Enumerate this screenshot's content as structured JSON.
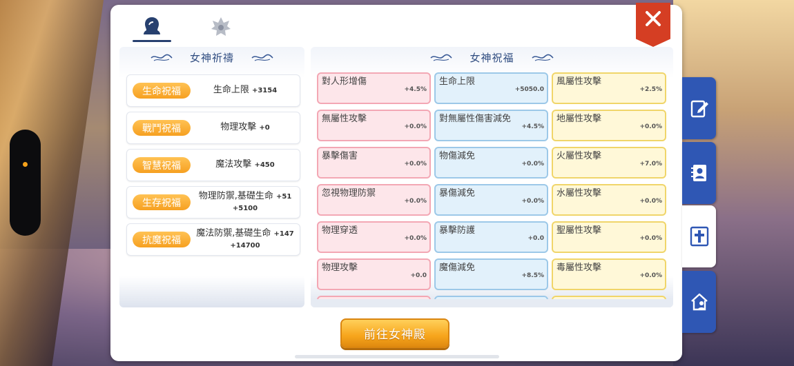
{
  "colors": {
    "accent_orange": "#f6a021",
    "title_blue": "#2f4c80",
    "close_red": "#d53e23",
    "side_tab_blue": "#2f57b4",
    "cell_pink": "#fde6ea",
    "cell_blue": "#e2f1fb",
    "cell_yellow": "#fff8d8"
  },
  "top_tabs": [
    {
      "icon": "goddess-icon",
      "active": true
    },
    {
      "icon": "emblem-icon",
      "active": false
    }
  ],
  "close": {
    "icon": "close-icon"
  },
  "prayer": {
    "title": "女神祈禱",
    "items": [
      {
        "badge": "生命祝福",
        "stat": "生命上限",
        "bonus": "+3154",
        "sub": ""
      },
      {
        "badge": "戰鬥祝福",
        "stat": "物理攻擊",
        "bonus": "+0",
        "sub": ""
      },
      {
        "badge": "智慧祝福",
        "stat": "魔法攻擊",
        "bonus": "+450",
        "sub": ""
      },
      {
        "badge": "生存祝福",
        "stat": "物理防禦,基礎生命",
        "bonus": "+51",
        "sub": "+5100"
      },
      {
        "badge": "抗魔祝福",
        "stat": "魔法防禦,基礎生命",
        "bonus": "+147",
        "sub": "+14700"
      }
    ]
  },
  "blessing": {
    "title": "女神祝福",
    "rows": [
      [
        {
          "name": "對人形增傷",
          "value": "+4.5%"
        },
        {
          "name": "生命上限",
          "value": "+5050.0"
        },
        {
          "name": "風屬性攻擊",
          "value": "+2.5%"
        }
      ],
      [
        {
          "name": "無屬性攻擊",
          "value": "+0.0%"
        },
        {
          "name": "對無屬性傷害減免",
          "value": "+4.5%"
        },
        {
          "name": "地屬性攻擊",
          "value": "+0.0%"
        }
      ],
      [
        {
          "name": "暴擊傷害",
          "value": "+0.0%"
        },
        {
          "name": "物傷減免",
          "value": "+0.0%"
        },
        {
          "name": "火屬性攻擊",
          "value": "+7.0%"
        }
      ],
      [
        {
          "name": "忽視物理防禦",
          "value": "+0.0%"
        },
        {
          "name": "暴傷減免",
          "value": "+0.0%"
        },
        {
          "name": "水屬性攻擊",
          "value": "+0.0%"
        }
      ],
      [
        {
          "name": "物理穿透",
          "value": "+0.0%"
        },
        {
          "name": "暴擊防護",
          "value": "+0.0"
        },
        {
          "name": "聖屬性攻擊",
          "value": "+0.0%"
        }
      ],
      [
        {
          "name": "物理攻擊",
          "value": "+0.0"
        },
        {
          "name": "魔傷減免",
          "value": "+8.5%"
        },
        {
          "name": "毒屬性攻擊",
          "value": "+0.0%"
        }
      ]
    ]
  },
  "go_button": "前往女神殿",
  "side_tabs": [
    {
      "icon": "edit-icon",
      "active": false
    },
    {
      "icon": "contacts-book-icon",
      "active": false
    },
    {
      "icon": "cross-icon",
      "active": true
    },
    {
      "icon": "guild-home-icon",
      "active": false
    }
  ]
}
